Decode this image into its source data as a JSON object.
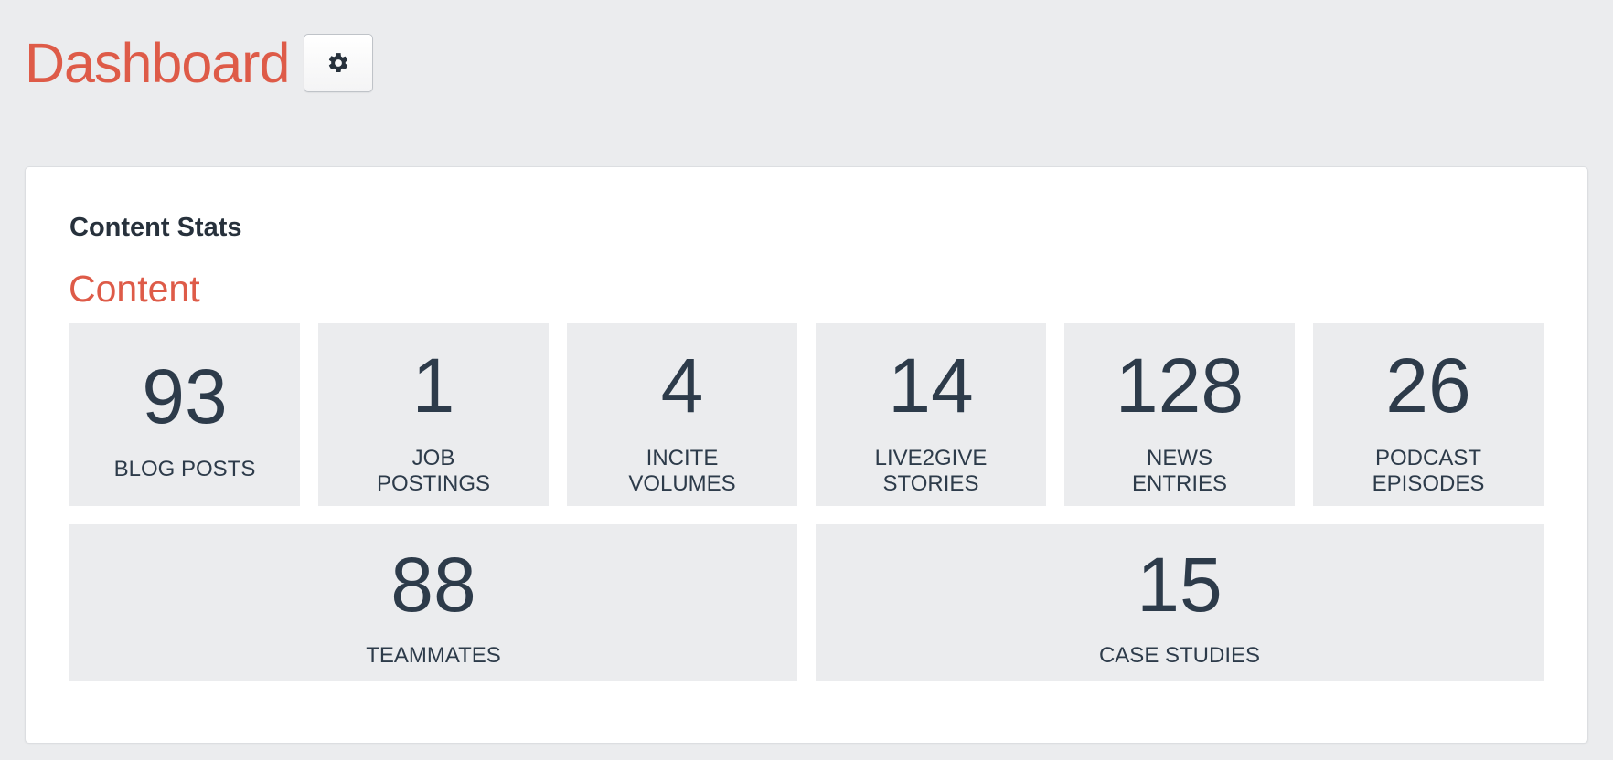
{
  "page": {
    "title": "Dashboard",
    "settings_icon": "gear-icon"
  },
  "card": {
    "title": "Content Stats",
    "section_title": "Content",
    "stats_row1": [
      {
        "value": "93",
        "label": "BLOG POSTS"
      },
      {
        "value": "1",
        "label": "JOB POSTINGS"
      },
      {
        "value": "4",
        "label": "INCITE VOLUMES"
      },
      {
        "value": "14",
        "label": "LIVE2GIVE STORIES"
      },
      {
        "value": "128",
        "label": "NEWS ENTRIES"
      },
      {
        "value": "26",
        "label": "PODCAST EPISODES"
      }
    ],
    "stats_row2": [
      {
        "value": "88",
        "label": "TEAMMATES"
      },
      {
        "value": "15",
        "label": "CASE STUDIES"
      }
    ]
  },
  "colors": {
    "accent": "#de5b48",
    "text": "#2d3b4a",
    "background": "#ebecee",
    "card": "#ffffff"
  }
}
